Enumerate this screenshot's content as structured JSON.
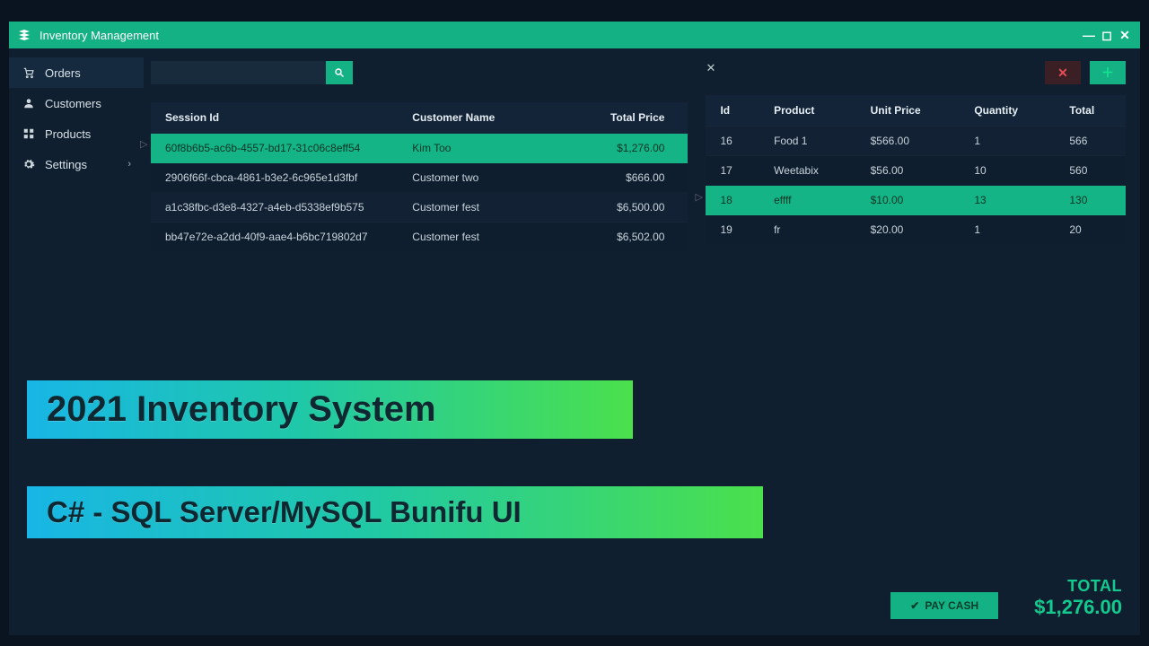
{
  "window": {
    "title": "Inventory Management"
  },
  "sidebar": {
    "items": [
      {
        "label": "Orders"
      },
      {
        "label": "Customers"
      },
      {
        "label": "Products"
      },
      {
        "label": "Settings"
      }
    ]
  },
  "orders_table": {
    "headers": {
      "session": "Session Id",
      "customer": "Customer Name",
      "total": "Total Price"
    },
    "rows": [
      {
        "session": "60f8b6b5-ac6b-4557-bd17-31c06c8eff54",
        "customer": "Kim Too",
        "total": "$1,276.00",
        "selected": true
      },
      {
        "session": "2906f66f-cbca-4861-b3e2-6c965e1d3fbf",
        "customer": "Customer two",
        "total": "$666.00"
      },
      {
        "session": "a1c38fbc-d3e8-4327-a4eb-d5338ef9b575",
        "customer": "Customer   fest",
        "total": "$6,500.00"
      },
      {
        "session": "bb47e72e-a2dd-40f9-aae4-b6bc719802d7",
        "customer": "Customer   fest",
        "total": "$6,502.00"
      }
    ]
  },
  "items_table": {
    "headers": {
      "id": "Id",
      "product": "Product",
      "unit": "Unit Price",
      "qty": "Quantity",
      "total": "Total"
    },
    "rows": [
      {
        "id": "16",
        "product": "Food 1",
        "unit": "$566.00",
        "qty": "1",
        "total": "566"
      },
      {
        "id": "17",
        "product": "Weetabix",
        "unit": "$56.00",
        "qty": "10",
        "total": "560"
      },
      {
        "id": "18",
        "product": "effff",
        "unit": "$10.00",
        "qty": "13",
        "total": "130",
        "selected": true
      },
      {
        "id": "19",
        "product": "fr",
        "unit": "$20.00",
        "qty": "1",
        "total": "20"
      }
    ]
  },
  "footer": {
    "pay_label": "PAY CASH",
    "total_label": "TOTAL",
    "total_value": "$1,276.00"
  },
  "banners": {
    "b1": "2021 Inventory System",
    "b2": "C# - SQL Server/MySQL Bunifu UI"
  }
}
